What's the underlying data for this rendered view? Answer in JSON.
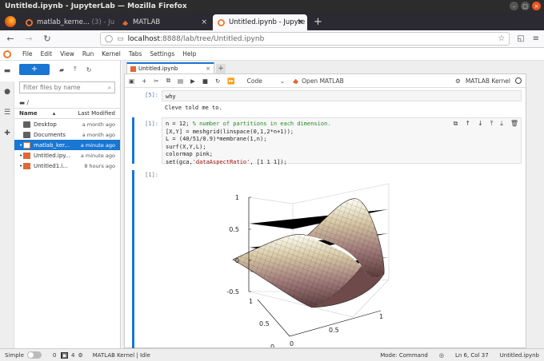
{
  "window": {
    "title": "Untitled.ipynb - JupyterLab — Mozilla Firefox"
  },
  "browser_tabs": [
    {
      "label": "matlab_kerne...",
      "label2": "(3) - Ju",
      "icon": "jupyter-icon"
    },
    {
      "label": "MATLAB",
      "icon": "matlab-icon"
    },
    {
      "label": "Untitled.ipynb - Jupyte",
      "icon": "jupyter-icon"
    }
  ],
  "url": {
    "host": "localhost",
    "path": ":8888/lab/tree/Untitled.ipynb"
  },
  "menu": [
    "File",
    "Edit",
    "View",
    "Run",
    "Kernel",
    "Tabs",
    "Settings",
    "Help"
  ],
  "filebrowser": {
    "new_label": "+",
    "filter_placeholder": "Filter files by name",
    "breadcrumb": "/",
    "col_name": "Name",
    "col_modified": "Last Modified",
    "files": [
      {
        "name": "Desktop",
        "modified": "a month ago",
        "type": "folder"
      },
      {
        "name": "Documents",
        "modified": "a month ago",
        "type": "folder"
      },
      {
        "name": "matlab_ker...",
        "modified": "a minute ago",
        "type": "notebook"
      },
      {
        "name": "Untitled.ipy...",
        "modified": "a minute ago",
        "type": "notebook"
      },
      {
        "name": "Untitled1.i...",
        "modified": "8 hours ago",
        "type": "notebook"
      }
    ]
  },
  "notebook": {
    "tab_label": "Untitled.ipynb",
    "cell_type": "Code",
    "open_matlab": "Open MATLAB",
    "kernel": "MATLAB Kernel",
    "cell1": {
      "prompt": "[5]:",
      "code": "why",
      "output": "Cleve told me to."
    },
    "cell2": {
      "prompt": "[1]:",
      "line1_code": "n = 12; ",
      "line1_comment": "% number of partitions in each dimension.",
      "line2": "[X,Y] = meshgrid(linspace(0,1,2*n+1));",
      "line3": "L = (40/51/0.9)*membrane(1,n);",
      "line4": "surf(X,Y,L);",
      "line5": "colormap pink;",
      "line6_a": "set(gca,",
      "line6_str": "'dataAspectRatio'",
      "line6_b": ", [1 1 1]);"
    },
    "cell3": {
      "prompt": "[1]:"
    }
  },
  "plot": {
    "z_ticks": [
      "1",
      "0.5",
      "0",
      "-0.5"
    ],
    "y_ticks": [
      "0",
      "0.5",
      "1"
    ],
    "x_ticks": [
      "0",
      "0.5",
      "1"
    ]
  },
  "status": {
    "mode_label": "Simple",
    "count1": "0",
    "count2": "4",
    "kernel_status": "MATLAB Kernel | Idle",
    "mode": "Mode: Command",
    "position": "Ln 6, Col 37",
    "file": "Untitled.ipynb"
  }
}
